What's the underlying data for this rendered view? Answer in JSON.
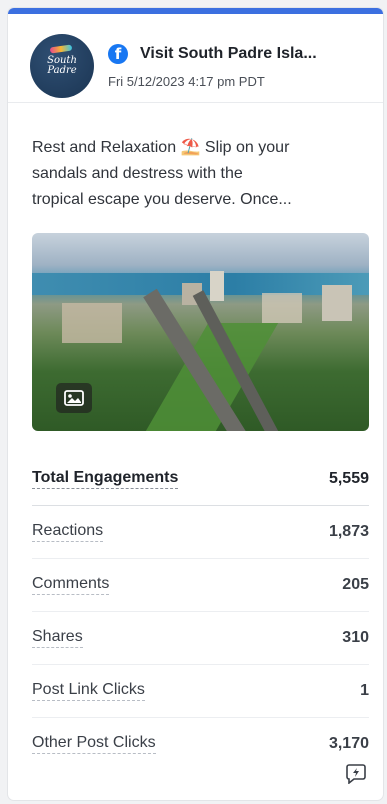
{
  "post": {
    "page_name": "Visit South Padre Isla...",
    "date": "Fri 5/12/2023 4:17 pm PDT",
    "avatar_text_line1": "South",
    "avatar_text_line2": "Padre",
    "platform_icon": "facebook-icon",
    "caption_line1": "Rest and Relaxation ",
    "caption_emoji": "⛱️",
    "caption_line1b": " Slip on your",
    "caption_line2": "sandals and destress with the",
    "caption_line3": "tropical escape you deserve. Once...",
    "image_badge_icon": "image-icon"
  },
  "metrics": {
    "total": {
      "label": "Total Engagements",
      "value": "5,559"
    },
    "reactions": {
      "label": "Reactions",
      "value": "1,873"
    },
    "comments": {
      "label": "Comments",
      "value": "205"
    },
    "shares": {
      "label": "Shares",
      "value": "310"
    },
    "post_link_clicks": {
      "label": "Post Link Clicks",
      "value": "1"
    },
    "other_post_clicks": {
      "label": "Other Post Clicks",
      "value": "3,170"
    }
  },
  "footer": {
    "icon": "boost-icon"
  },
  "colors": {
    "accent": "#3b6fe0",
    "facebook": "#1877f2"
  }
}
